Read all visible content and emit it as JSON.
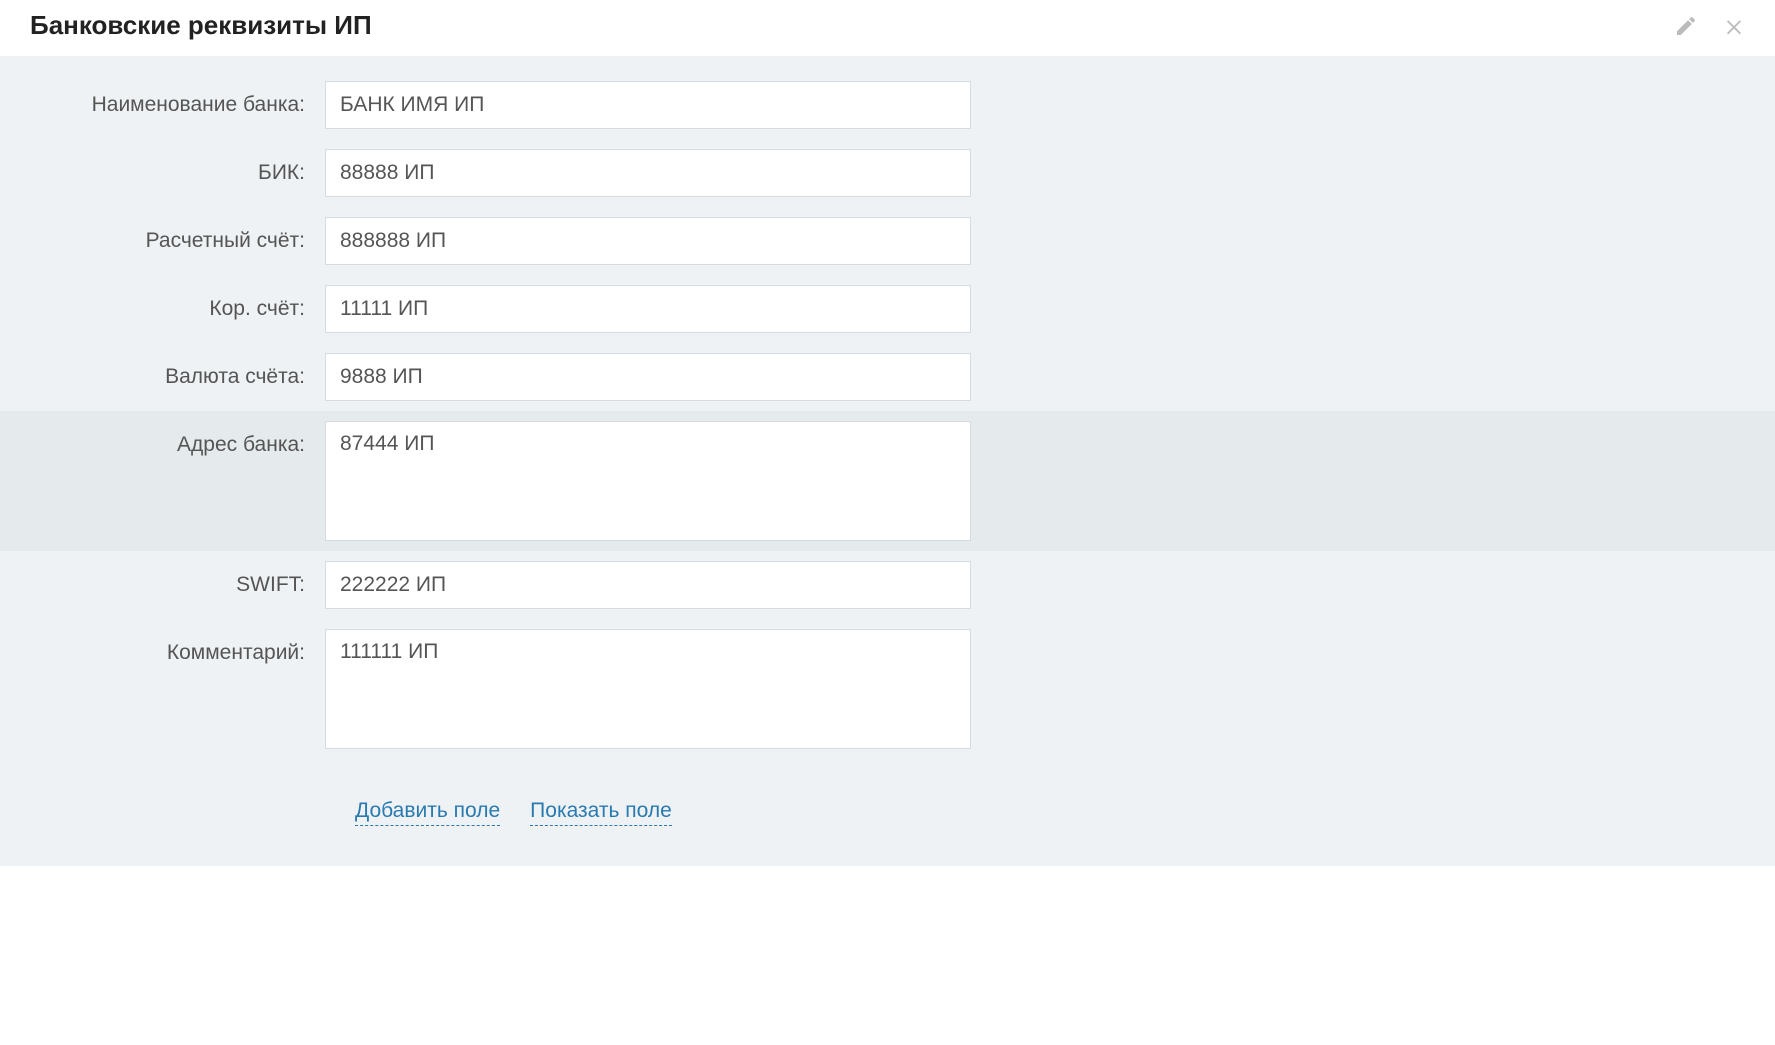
{
  "header": {
    "title": "Банковские реквизиты ИП"
  },
  "fields": {
    "bank_name": {
      "label": "Наименование банка:",
      "value": "БАНК ИМЯ ИП"
    },
    "bic": {
      "label": "БИК:",
      "value": "88888 ИП"
    },
    "account": {
      "label": "Расчетный счёт:",
      "value": "888888 ИП"
    },
    "corr_account": {
      "label": "Кор. счёт:",
      "value": "11111 ИП"
    },
    "currency": {
      "label": "Валюта счёта:",
      "value": "9888 ИП"
    },
    "bank_address": {
      "label": "Адрес банка:",
      "value": "87444 ИП"
    },
    "swift": {
      "label": "SWIFT:",
      "value": "222222 ИП"
    },
    "comment": {
      "label": "Комментарий:",
      "value": "111111 ИП"
    }
  },
  "actions": {
    "add_field": "Добавить поле",
    "show_field": "Показать поле"
  }
}
